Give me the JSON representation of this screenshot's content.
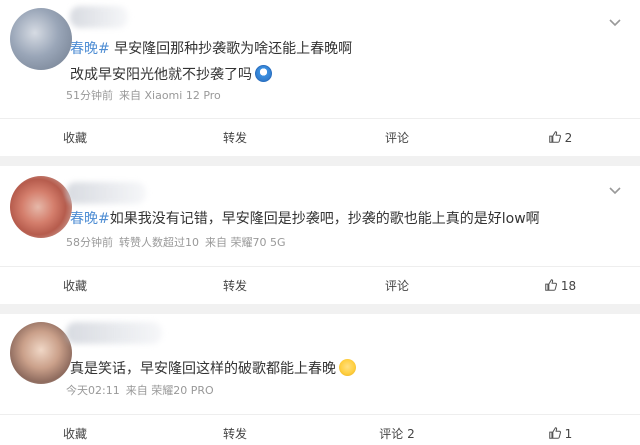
{
  "posts": [
    {
      "lines": [
        {
          "topic": "春晚#",
          "text": " 早安隆回那种抄袭歌为啥还能上春晚啊"
        },
        {
          "topic": "",
          "text": "改成早安阳光他就不抄袭了吗"
        }
      ],
      "emoji": "doge-emoji",
      "meta": {
        "time": "51分钟前",
        "source": "来自 Xiaomi 12 Pro",
        "extra": ""
      },
      "actions": {
        "favorite": "收藏",
        "forward": "转发",
        "comment": "评论",
        "like_count": "2"
      }
    },
    {
      "lines": [
        {
          "topic": "春晚#",
          "text": "如果我没有记错，早安隆回是抄袭吧，抄袭的歌也能上真的是好low啊"
        }
      ],
      "emoji": "",
      "meta": {
        "time": "58分钟前",
        "extra": "转赞人数超过10",
        "source": "来自 荣耀70 5G"
      },
      "actions": {
        "favorite": "收藏",
        "forward": "转发",
        "comment": "评论",
        "like_count": "18"
      }
    },
    {
      "lines": [
        {
          "topic": "",
          "text": "真是笑话，早安隆回这样的破歌都能上春晚"
        }
      ],
      "emoji": "crying-laughing-emoji",
      "meta": {
        "time": "今天02:11",
        "source": "来自 荣耀20 PRO",
        "extra": ""
      },
      "actions": {
        "favorite": "收藏",
        "forward": "转发",
        "comment": "评论 2",
        "like_count": "1"
      }
    }
  ],
  "icons": {
    "chevron": "chevron-down-icon",
    "like": "thumbs-up-icon"
  },
  "colors": {
    "topic": "#4f8ed4",
    "meta": "#999999",
    "divider": "#f1f1f1"
  }
}
